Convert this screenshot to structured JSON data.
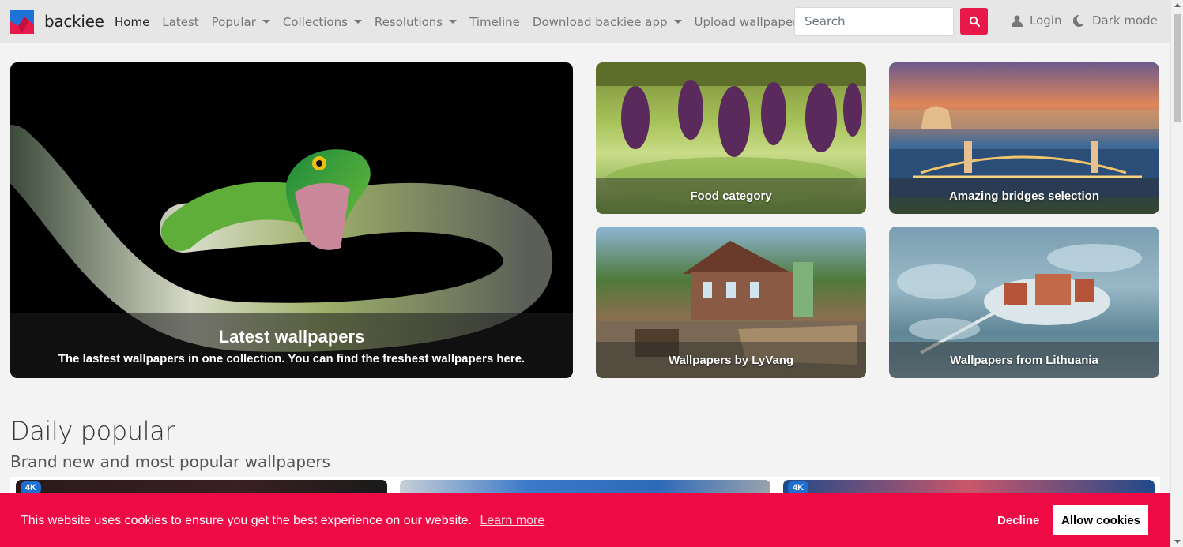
{
  "brand": {
    "name": "backiee"
  },
  "nav": {
    "items": [
      {
        "label": "Home",
        "active": true,
        "dropdown": false
      },
      {
        "label": "Latest",
        "active": false,
        "dropdown": false
      },
      {
        "label": "Popular",
        "active": false,
        "dropdown": true
      },
      {
        "label": "Collections",
        "active": false,
        "dropdown": true
      },
      {
        "label": "Resolutions",
        "active": false,
        "dropdown": true
      },
      {
        "label": "Timeline",
        "active": false,
        "dropdown": false
      },
      {
        "label": "Download backiee app",
        "active": false,
        "dropdown": true
      },
      {
        "label": "Upload wallpaper",
        "active": false,
        "dropdown": false
      }
    ],
    "search_placeholder": "Search",
    "login_label": "Login",
    "darkmode_label": "Dark mode"
  },
  "hero": {
    "title": "Latest wallpapers",
    "description": "The lastest wallpapers in one collection. You can find the freshest wallpapers here."
  },
  "tiles": [
    {
      "label": "Food category"
    },
    {
      "label": "Amazing bridges selection"
    },
    {
      "label": "Wallpapers by LyVang"
    },
    {
      "label": "Wallpapers from Lithuania"
    }
  ],
  "section": {
    "title": "Daily popular",
    "subtitle": "Brand new and most popular wallpapers"
  },
  "thumbs": [
    {
      "badge": "4K"
    },
    {
      "badge": ""
    },
    {
      "badge": "4K"
    }
  ],
  "cookie": {
    "text": "This website uses cookies to ensure you get the best experience on our website.",
    "learn_more": "Learn more",
    "decline": "Decline",
    "allow": "Allow cookies"
  },
  "colors": {
    "accent": "#e8194a",
    "cookie_bg": "#ee0a45",
    "badge": "#1e6fd0"
  }
}
